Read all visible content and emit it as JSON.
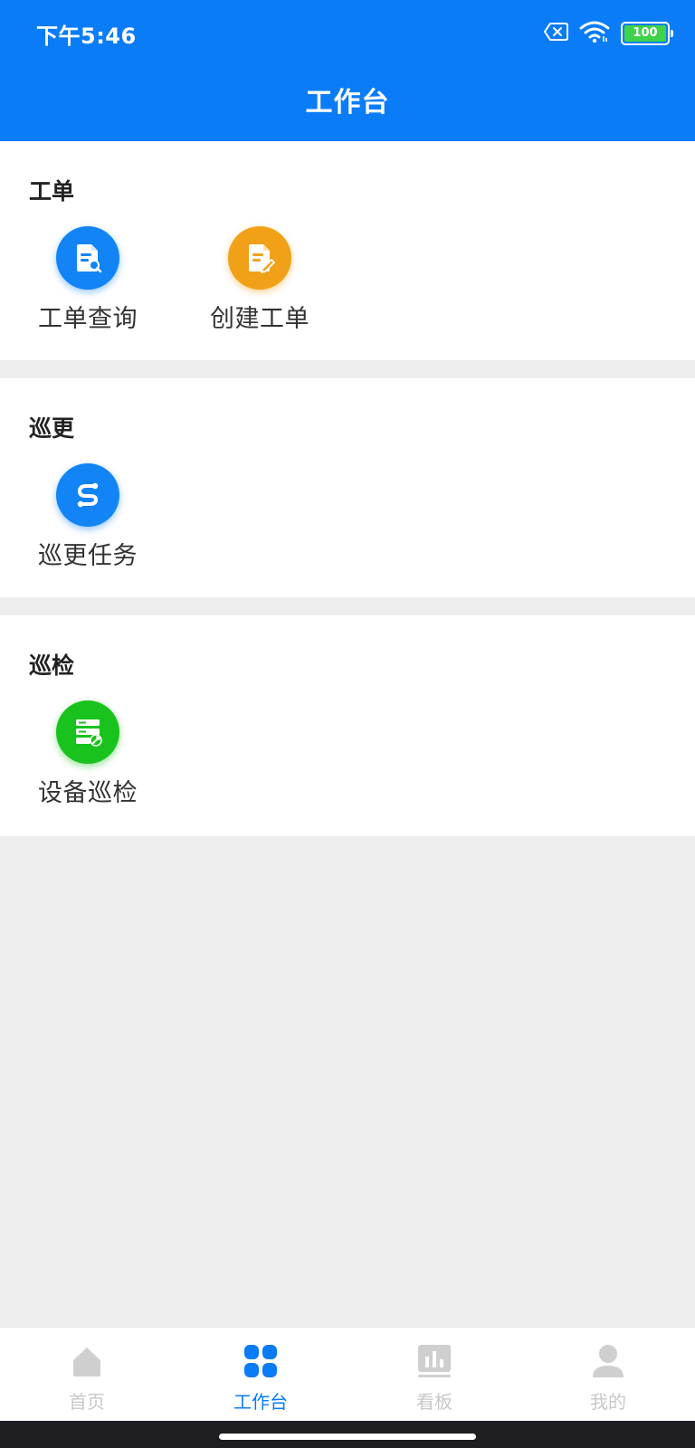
{
  "status_bar": {
    "time": "下午5:46",
    "battery": "100",
    "icons": [
      "sim-error-icon",
      "wifi-icon",
      "battery-icon"
    ]
  },
  "header": {
    "title": "工作台"
  },
  "sections": [
    {
      "title": "工单",
      "tiles": [
        {
          "label": "工单查询",
          "icon": "document-search-icon",
          "color": "#1284f5"
        },
        {
          "label": "创建工单",
          "icon": "document-edit-icon",
          "color": "#f0a117"
        }
      ]
    },
    {
      "title": "巡更",
      "tiles": [
        {
          "label": "巡更任务",
          "icon": "route-icon",
          "color": "#1284f5"
        }
      ]
    },
    {
      "title": "巡检",
      "tiles": [
        {
          "label": "设备巡检",
          "icon": "server-wrench-icon",
          "color": "#19c21c"
        }
      ]
    }
  ],
  "tabbar": {
    "items": [
      {
        "label": "首页",
        "icon": "home-icon",
        "active": false
      },
      {
        "label": "工作台",
        "icon": "grid-icon",
        "active": true
      },
      {
        "label": "看板",
        "icon": "bar-chart-icon",
        "active": false
      },
      {
        "label": "我的",
        "icon": "user-icon",
        "active": false
      }
    ]
  },
  "colors": {
    "primary": "#0a7cf7",
    "background": "#eeeeee",
    "tab_inactive": "#c8c8c8",
    "battery_fill": "#3ed34a"
  }
}
